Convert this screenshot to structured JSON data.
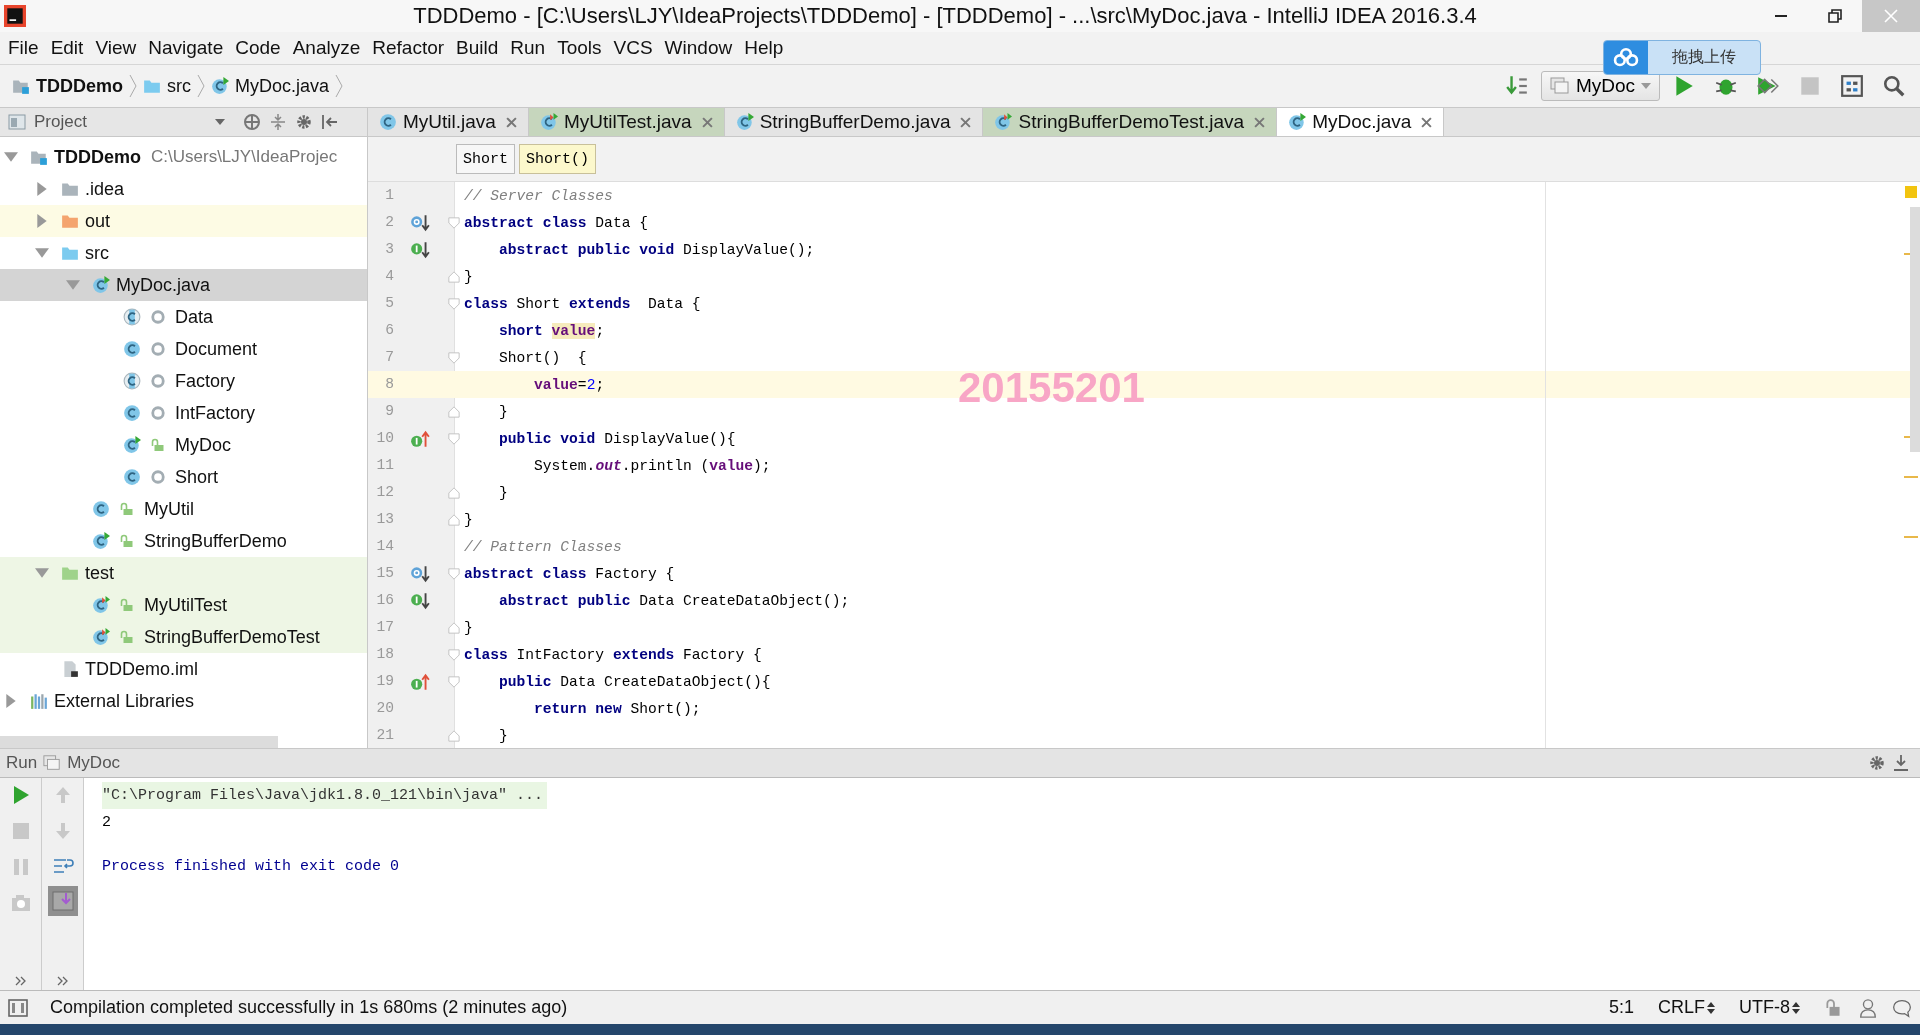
{
  "window": {
    "title": "TDDDemo - [C:\\Users\\LJY\\IdeaProjects\\TDDDemo] - [TDDDemo] - ...\\src\\MyDoc.java - IntelliJ IDEA 2016.3.4"
  },
  "menu": [
    "File",
    "Edit",
    "View",
    "Navigate",
    "Code",
    "Analyze",
    "Refactor",
    "Build",
    "Run",
    "Tools",
    "VCS",
    "Window",
    "Help"
  ],
  "breadcrumbs": [
    {
      "label": "TDDDemo",
      "kind": "project"
    },
    {
      "label": "src",
      "kind": "folder-blue"
    },
    {
      "label": "MyDoc.java",
      "kind": "class-run"
    }
  ],
  "run_config": {
    "label": "MyDoc"
  },
  "upload_widget": {
    "label": "拖拽上传"
  },
  "project_panel": {
    "title": "Project",
    "tree": [
      {
        "label": "TDDDemo",
        "path": "C:\\Users\\LJY\\IdeaProjec",
        "kind": "project",
        "expanded": true,
        "selected": false,
        "children": [
          {
            "label": ".idea",
            "kind": "folder-gray",
            "expanded": false,
            "selected": false
          },
          {
            "label": "out",
            "kind": "folder-orange",
            "expanded": false,
            "selected": false,
            "color": "#fdfbe4"
          },
          {
            "label": "src",
            "kind": "folder-blue",
            "expanded": true,
            "selected": false,
            "children": [
              {
                "label": "MyDoc.java",
                "kind": "class-run",
                "expanded": true,
                "selected": true,
                "children": [
                  {
                    "label": "Data",
                    "kind": "abstract-class",
                    "public": false,
                    "selected": false
                  },
                  {
                    "label": "Document",
                    "kind": "class",
                    "public": false,
                    "selected": false
                  },
                  {
                    "label": "Factory",
                    "kind": "abstract-class",
                    "public": false,
                    "selected": false
                  },
                  {
                    "label": "IntFactory",
                    "kind": "class",
                    "public": false,
                    "selected": false
                  },
                  {
                    "label": "MyDoc",
                    "kind": "class-run",
                    "public": true,
                    "selected": false
                  },
                  {
                    "label": "Short",
                    "kind": "class",
                    "public": false,
                    "selected": false
                  }
                ]
              },
              {
                "label": "MyUtil",
                "kind": "class",
                "public": true,
                "selected": false
              },
              {
                "label": "StringBufferDemo",
                "kind": "class-run",
                "public": true,
                "selected": false
              }
            ]
          },
          {
            "label": "test",
            "kind": "folder-green",
            "expanded": true,
            "selected": false,
            "color": "#eef6e5",
            "children": [
              {
                "label": "MyUtilTest",
                "kind": "test-class",
                "public": true,
                "selected": false,
                "color": "#eef6e5"
              },
              {
                "label": "StringBufferDemoTest",
                "kind": "test-class",
                "public": true,
                "selected": false,
                "color": "#eef6e5"
              }
            ]
          },
          {
            "label": "TDDDemo.iml",
            "kind": "iml",
            "selected": false
          }
        ]
      },
      {
        "label": "External Libraries",
        "kind": "libraries",
        "expanded": false,
        "selected": false
      }
    ]
  },
  "tabs": [
    {
      "label": "MyUtil.java",
      "kind": "class",
      "selected": false
    },
    {
      "label": "MyUtilTest.java",
      "kind": "test-class",
      "selected": false,
      "color": "#c6d6bd"
    },
    {
      "label": "StringBufferDemo.java",
      "kind": "class-run",
      "selected": false
    },
    {
      "label": "StringBufferDemoTest.java",
      "kind": "test-class",
      "selected": false,
      "color": "#c6d6bd"
    },
    {
      "label": "MyDoc.java",
      "kind": "class-run",
      "selected": true
    }
  ],
  "structure_crumbs": [
    {
      "label": "Short",
      "selected": false
    },
    {
      "label": "Short()",
      "selected": true
    }
  ],
  "code": {
    "lines": [
      {
        "number": "1",
        "tokens": [
          {
            "kind": "comment",
            "text": "// Server Classes"
          }
        ]
      },
      {
        "number": "2",
        "gutter": {
          "kind": "implemented"
        },
        "fold": {
          "kind": "start"
        },
        "tokens": [
          {
            "kind": "kw",
            "text": "abstract class"
          },
          {
            "kind": "plain",
            "text": " Data {"
          }
        ]
      },
      {
        "number": "3",
        "gutter": {
          "kind": "implemented-method"
        },
        "tokens": [
          {
            "kind": "kw",
            "text": "    abstract public void"
          },
          {
            "kind": "plain",
            "text": " DisplayValue();"
          }
        ]
      },
      {
        "number": "4",
        "fold": {
          "kind": "end"
        },
        "tokens": [
          {
            "kind": "plain",
            "text": "}"
          }
        ]
      },
      {
        "number": "5",
        "fold": {
          "kind": "start"
        },
        "tokens": [
          {
            "kind": "kw",
            "text": "class"
          },
          {
            "kind": "plain",
            "text": " Short "
          },
          {
            "kind": "kw",
            "text": "extends"
          },
          {
            "kind": "plain",
            "text": "  Data {"
          }
        ]
      },
      {
        "number": "6",
        "tokens": [
          {
            "kind": "kw",
            "text": "    short "
          },
          {
            "kind": "usage",
            "text": "value"
          },
          {
            "kind": "plain",
            "text": ";"
          }
        ]
      },
      {
        "number": "7",
        "fold": {
          "kind": "start"
        },
        "tokens": [
          {
            "kind": "plain",
            "text": "    Short()  {"
          }
        ]
      },
      {
        "number": "8",
        "current": true,
        "tokens": [
          {
            "kind": "field",
            "text": "        value"
          },
          {
            "kind": "plain",
            "text": "="
          },
          {
            "kind": "num",
            "text": "2"
          },
          {
            "kind": "plain",
            "text": ";"
          }
        ]
      },
      {
        "number": "9",
        "fold": {
          "kind": "end"
        },
        "tokens": [
          {
            "kind": "plain",
            "text": "    }"
          }
        ]
      },
      {
        "number": "10",
        "gutter": {
          "kind": "implements"
        },
        "fold": {
          "kind": "start"
        },
        "tokens": [
          {
            "kind": "kw",
            "text": "    public void"
          },
          {
            "kind": "plain",
            "text": " DisplayValue(){"
          }
        ]
      },
      {
        "number": "11",
        "tokens": [
          {
            "kind": "plain",
            "text": "        System."
          },
          {
            "kind": "static",
            "text": "out"
          },
          {
            "kind": "plain",
            "text": ".println ("
          },
          {
            "kind": "field",
            "text": "value"
          },
          {
            "kind": "plain",
            "text": ");"
          }
        ]
      },
      {
        "number": "12",
        "fold": {
          "kind": "end"
        },
        "tokens": [
          {
            "kind": "plain",
            "text": "    }"
          }
        ]
      },
      {
        "number": "13",
        "fold": {
          "kind": "end"
        },
        "tokens": [
          {
            "kind": "plain",
            "text": "}"
          }
        ]
      },
      {
        "number": "14",
        "tokens": [
          {
            "kind": "comment",
            "text": "// Pattern Classes"
          }
        ]
      },
      {
        "number": "15",
        "gutter": {
          "kind": "implemented"
        },
        "fold": {
          "kind": "start"
        },
        "tokens": [
          {
            "kind": "kw",
            "text": "abstract class"
          },
          {
            "kind": "plain",
            "text": " Factory {"
          }
        ]
      },
      {
        "number": "16",
        "gutter": {
          "kind": "implemented-method"
        },
        "tokens": [
          {
            "kind": "kw",
            "text": "    abstract public"
          },
          {
            "kind": "plain",
            "text": " Data CreateDataObject();"
          }
        ]
      },
      {
        "number": "17",
        "fold": {
          "kind": "end"
        },
        "tokens": [
          {
            "kind": "plain",
            "text": "}"
          }
        ]
      },
      {
        "number": "18",
        "fold": {
          "kind": "start"
        },
        "tokens": [
          {
            "kind": "kw",
            "text": "class"
          },
          {
            "kind": "plain",
            "text": " IntFactory "
          },
          {
            "kind": "kw",
            "text": "extends"
          },
          {
            "kind": "plain",
            "text": " Factory {"
          }
        ]
      },
      {
        "number": "19",
        "gutter": {
          "kind": "implements"
        },
        "fold": {
          "kind": "start"
        },
        "tokens": [
          {
            "kind": "kw",
            "text": "    public"
          },
          {
            "kind": "plain",
            "text": " Data CreateDataObject(){"
          }
        ]
      },
      {
        "number": "20",
        "tokens": [
          {
            "kind": "kw",
            "text": "        return new"
          },
          {
            "kind": "plain",
            "text": " Short();"
          }
        ]
      },
      {
        "number": "21",
        "fold": {
          "kind": "end"
        },
        "tokens": [
          {
            "kind": "plain",
            "text": "    }"
          }
        ]
      }
    ]
  },
  "overlay_text": "20155201",
  "run_panel": {
    "title": "Run",
    "config": "MyDoc",
    "console": [
      {
        "kind": "command",
        "text": "\"C:\\Program Files\\Java\\jdk1.8.0_121\\bin\\java\" ..."
      },
      {
        "kind": "output",
        "text": "2"
      },
      {
        "kind": "system",
        "text": "Process finished with exit code 0"
      }
    ]
  },
  "status_bar": {
    "message": "Compilation completed successfully in 1s 680ms (2 minutes ago)",
    "position": "5:1",
    "line_separator": "CRLF",
    "encoding": "UTF-8"
  }
}
